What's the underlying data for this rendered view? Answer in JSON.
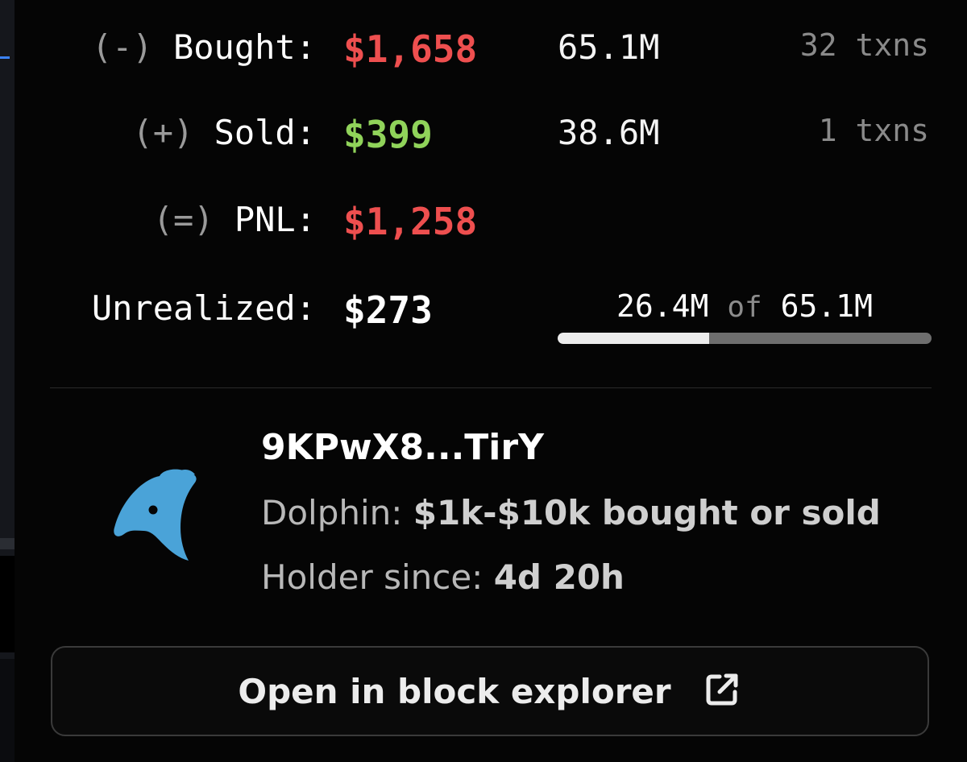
{
  "stats": {
    "bought": {
      "sign": "(-)",
      "label": "Bought:",
      "value": "$1,658",
      "amount": "65.1M",
      "txns": "32 txns"
    },
    "sold": {
      "sign": "(+)",
      "label": "Sold:",
      "value": "$399",
      "amount": "38.6M",
      "txns": "1 txns"
    },
    "pnl": {
      "sign": "(=)",
      "label": "PNL:",
      "value": "$1,258"
    },
    "unrealized": {
      "label": "Unrealized:",
      "value": "$273"
    }
  },
  "holding": {
    "current": "26.4M",
    "of_word": "of",
    "total": "65.1M",
    "fraction": 0.4055
  },
  "wallet": {
    "address": "9KPwX8...TirY",
    "tier_label": "Dolphin:",
    "tier_desc": "$1k-$10k bought or sold",
    "holder_label": "Holder since:",
    "holder_value": "4d 20h",
    "icon": "dolphin-icon"
  },
  "actions": {
    "explorer_label": "Open in block explorer",
    "explorer_icon": "external-link-icon"
  },
  "colors": {
    "negative": "#ee4f4f",
    "positive": "#90d35a",
    "dolphin": "#4aa3d8"
  }
}
